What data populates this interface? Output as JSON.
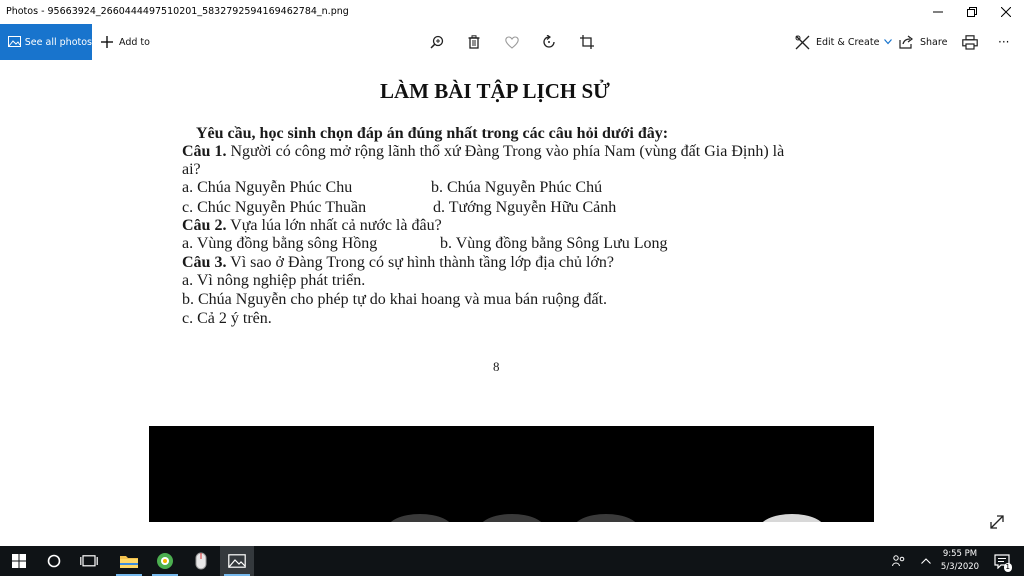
{
  "window": {
    "title": "Photos - 95663924_2660444497510201_5832792594169462784_n.png"
  },
  "toolbar": {
    "see_all_photos": "See all photos",
    "add_to": "Add to",
    "edit_create": "Edit & Create",
    "share": "Share",
    "more": "···"
  },
  "document": {
    "title": "LÀM BÀI TẬP LỊCH SỬ",
    "instruction": "Yêu cầu, học sinh chọn đáp án đúng nhất trong các câu hỏi dưới đây:",
    "q1_label": "Câu 1.",
    "q1_text": " Người có công mở rộng lãnh thổ xứ Đàng Trong vào phía Nam (vùng đất Gia Định) là",
    "q1_text_cont": "ai?",
    "q1_a": "a. Chúa Nguyễn Phúc Chu",
    "q1_b": "b. Chúa Nguyễn Phúc Chú",
    "q1_c": "c. Chúc Nguyễn Phúc Thuần",
    "q1_d": "d. Tướng Nguyễn Hữu Cảnh",
    "q2_label": "Câu 2.",
    "q2_text": " Vựa lúa lớn nhất cả nước là đâu?",
    "q2_a": "a. Vùng đồng bằng sông Hồng",
    "q2_b": "b. Vùng đồng bằng Sông Lưu Long",
    "q3_label": "Câu 3.",
    "q3_text": " Vì sao ở Đàng Trong có sự hình thành tầng lớp địa chủ lớn?",
    "q3_a": "a. Vì nông nghiệp phát triển.",
    "q3_b": "b. Chúa Nguyễn cho phép tự do khai hoang và mua bán ruộng đất.",
    "q3_c": "c. Cả 2 ý trên.",
    "page_number": "8"
  },
  "taskbar": {
    "time": "9:55 PM",
    "date": "5/3/2020",
    "notification_count": "1"
  },
  "colors": {
    "accent": "#1874cd",
    "taskbar": "#0f1316"
  }
}
